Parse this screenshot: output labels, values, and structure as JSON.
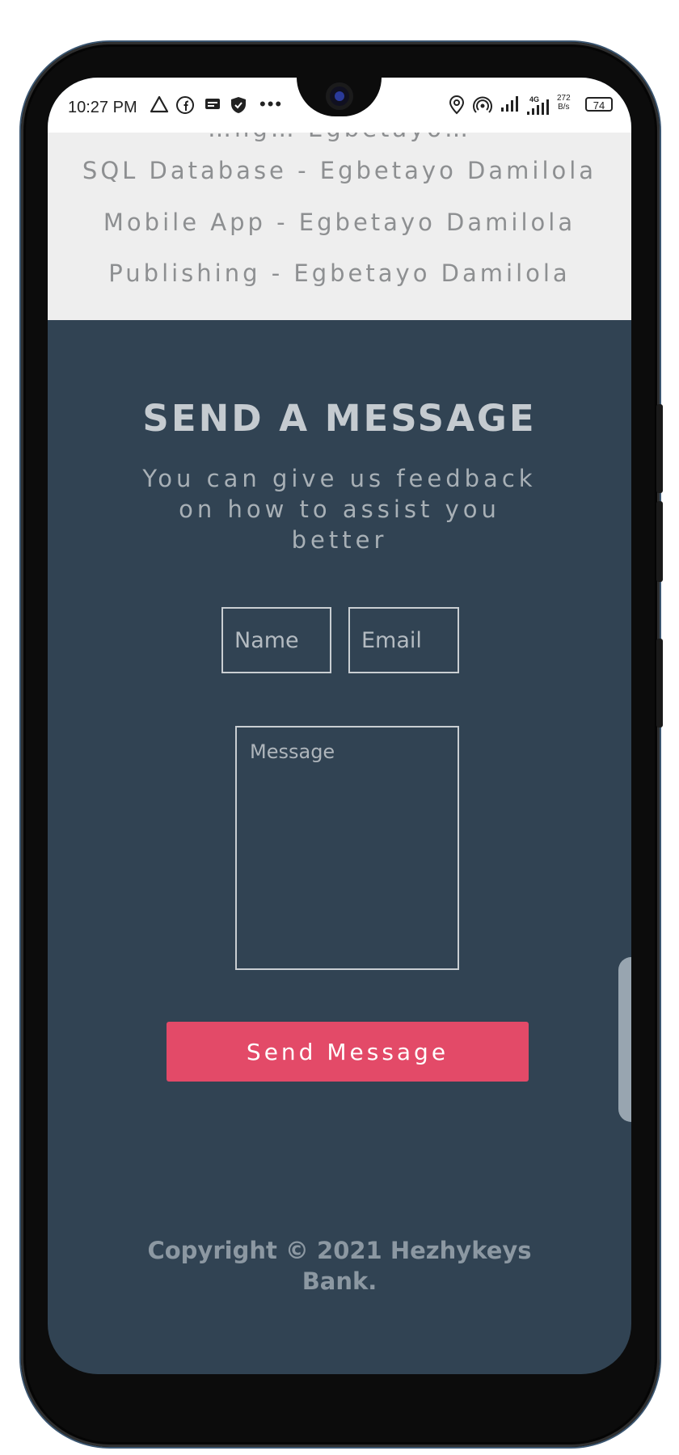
{
  "status_bar": {
    "time": "10:27 PM",
    "left_icons": [
      "triangle-app-icon",
      "facebook-icon",
      "message-icon",
      "shield-icon"
    ],
    "more": "•••",
    "right_icons": [
      "location-icon",
      "hotspot-icon",
      "signal-icon",
      "signal-4g-icon"
    ],
    "net_speed": "272\nB/s",
    "battery": "74"
  },
  "credits": {
    "partial_top": "…ng… Egbetayo…",
    "lines": [
      "SQL Database - Egbetayo Damilola",
      "Mobile App - Egbetayo Damilola",
      "Publishing - Egbetayo Damilola"
    ]
  },
  "contact": {
    "title": "SEND A MESSAGE",
    "subtitle": "You can give us feedback on how to assist you better",
    "name_placeholder": "Name",
    "email_placeholder": "Email",
    "message_placeholder": "Message",
    "send_label": "Send Message"
  },
  "footer": {
    "copyright": "Copyright © 2021 Hezhykeys Bank."
  },
  "colors": {
    "background": "#314353",
    "credits_bg": "#eeeeee",
    "accent": "#e34a68"
  }
}
